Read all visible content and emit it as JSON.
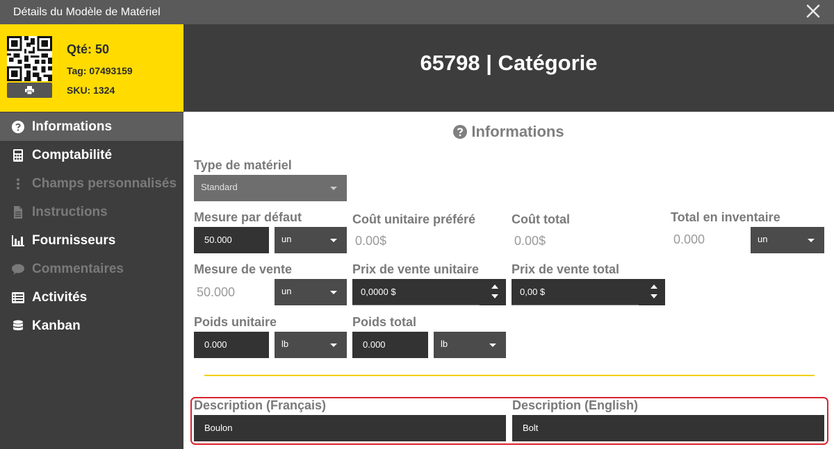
{
  "window": {
    "title": "Détails du Modèle de Matériel"
  },
  "card": {
    "qty": "Qté: 50",
    "tag": "Tag: 07493159",
    "sku": "SKU: 1324"
  },
  "header": {
    "title": "65798 | Catégorie"
  },
  "sidebar": {
    "items": [
      {
        "label": "Informations",
        "icon": "question-circle-icon",
        "state": "active"
      },
      {
        "label": "Comptabilité",
        "icon": "calculator-icon",
        "state": "normal"
      },
      {
        "label": "Champs personnalisés",
        "icon": "ellipsis-vertical-icon",
        "state": "disabled"
      },
      {
        "label": "Instructions",
        "icon": "document-icon",
        "state": "disabled"
      },
      {
        "label": "Fournisseurs",
        "icon": "bar-chart-icon",
        "state": "normal"
      },
      {
        "label": "Commentaires",
        "icon": "comment-icon",
        "state": "disabled"
      },
      {
        "label": "Activités",
        "icon": "list-icon",
        "state": "normal"
      },
      {
        "label": "Kanban",
        "icon": "database-icon",
        "state": "normal"
      }
    ]
  },
  "section": {
    "title": "Informations"
  },
  "form": {
    "material_type": {
      "label": "Type de matériel",
      "value": "Standard"
    },
    "default_measure": {
      "label": "Mesure par défaut",
      "value": "50.000",
      "unit": "un"
    },
    "preferred_unit_cost": {
      "label": "Coût unitaire préféré",
      "value": "0.00$"
    },
    "total_cost": {
      "label": "Coût total",
      "value": "0.00$"
    },
    "total_inventory": {
      "label": "Total en inventaire",
      "value": "0.000",
      "unit": "un"
    },
    "sale_measure": {
      "label": "Mesure de vente",
      "value": "50.000",
      "unit": "un"
    },
    "unit_sale_price": {
      "label": "Prix de vente unitaire",
      "value": "0,0000 $"
    },
    "total_sale_price": {
      "label": "Prix de vente total",
      "value": "0,00 $"
    },
    "unit_weight": {
      "label": "Poids unitaire",
      "value": "0.000",
      "unit": "lb"
    },
    "total_weight": {
      "label": "Poids total",
      "value": "0.000",
      "unit": "lb"
    },
    "description_fr": {
      "label": "Description (Français)",
      "value": "Boulon"
    },
    "description_en": {
      "label": "Description (English)",
      "value": "Bolt"
    }
  },
  "colors": {
    "accent": "#ffdb00",
    "sidebar": "#3d3d3d",
    "titlebar": "#5a5a5a",
    "highlight": "#d9232d"
  }
}
